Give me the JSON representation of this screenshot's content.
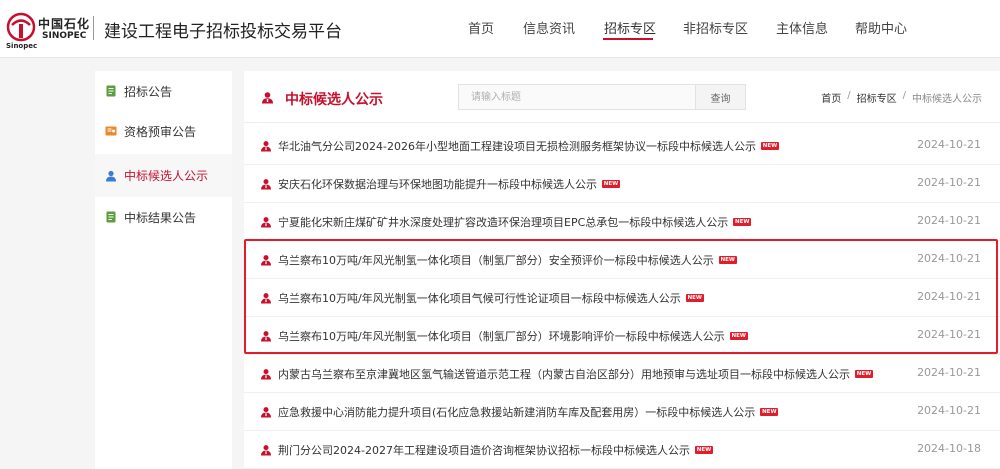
{
  "logo": {
    "cn": "中国石化",
    "en": "SINOPEC",
    "sub": "Sinopec"
  },
  "site_title": "建设工程电子招标投标交易平台",
  "nav": [
    {
      "label": "首页"
    },
    {
      "label": "信息资讯"
    },
    {
      "label": "招标专区"
    },
    {
      "label": "非招标专区"
    },
    {
      "label": "主体信息"
    },
    {
      "label": "帮助中心"
    }
  ],
  "sidebar": {
    "items": [
      {
        "label": "招标公告",
        "icon": "document-icon"
      },
      {
        "label": "资格预审公告",
        "icon": "certificate-icon"
      },
      {
        "label": "中标候选人公示",
        "icon": "user-icon"
      },
      {
        "label": "中标结果公告",
        "icon": "document-icon"
      }
    ]
  },
  "main": {
    "title": "中标候选人公示",
    "search": {
      "placeholder": "请输入标题",
      "button": "查询"
    },
    "breadcrumb": {
      "home": "首页",
      "section": "招标专区",
      "current": "中标候选人公示",
      "sep": "/"
    },
    "badge": "NEW",
    "rows": [
      {
        "title": "华北油气分公司2024-2026年小型地面工程建设项目无损检测服务框架协议一标段中标候选人公示",
        "date": "2024-10-21"
      },
      {
        "title": "安庆石化环保数据治理与环保地图功能提升一标段中标候选人公示",
        "date": "2024-10-21"
      },
      {
        "title": "宁夏能化宋新庄煤矿矿井水深度处理扩容改造环保治理项目EPC总承包一标段中标候选人公示",
        "date": "2024-10-21"
      },
      {
        "title": "乌兰察布10万吨/年风光制氢一体化项目（制氢厂部分）安全预评价一标段中标候选人公示",
        "date": "2024-10-21"
      },
      {
        "title": "乌兰察布10万吨/年风光制氢一体化项目气候可行性论证项目一标段中标候选人公示",
        "date": "2024-10-21"
      },
      {
        "title": "乌兰察布10万吨/年风光制氢一体化项目（制氢厂部分）环境影响评价一标段中标候选人公示",
        "date": "2024-10-21"
      },
      {
        "title": "内蒙古乌兰察布至京津冀地区氢气输送管道示范工程（内蒙古自治区部分）用地预审与选址项目一标段中标候选人公示",
        "date": "2024-10-21"
      },
      {
        "title": "应急救援中心消防能力提升项目(石化应急救援站新建消防车库及配套用房）一标段中标候选人公示",
        "date": "2024-10-21"
      },
      {
        "title": "荆门分公司2024-2027年工程建设项目造价咨询框架协议招标一标段中标候选人公示",
        "date": "2024-10-18"
      }
    ]
  },
  "colors": {
    "accent": "#c8102e",
    "highlight": "#e11d2b"
  }
}
